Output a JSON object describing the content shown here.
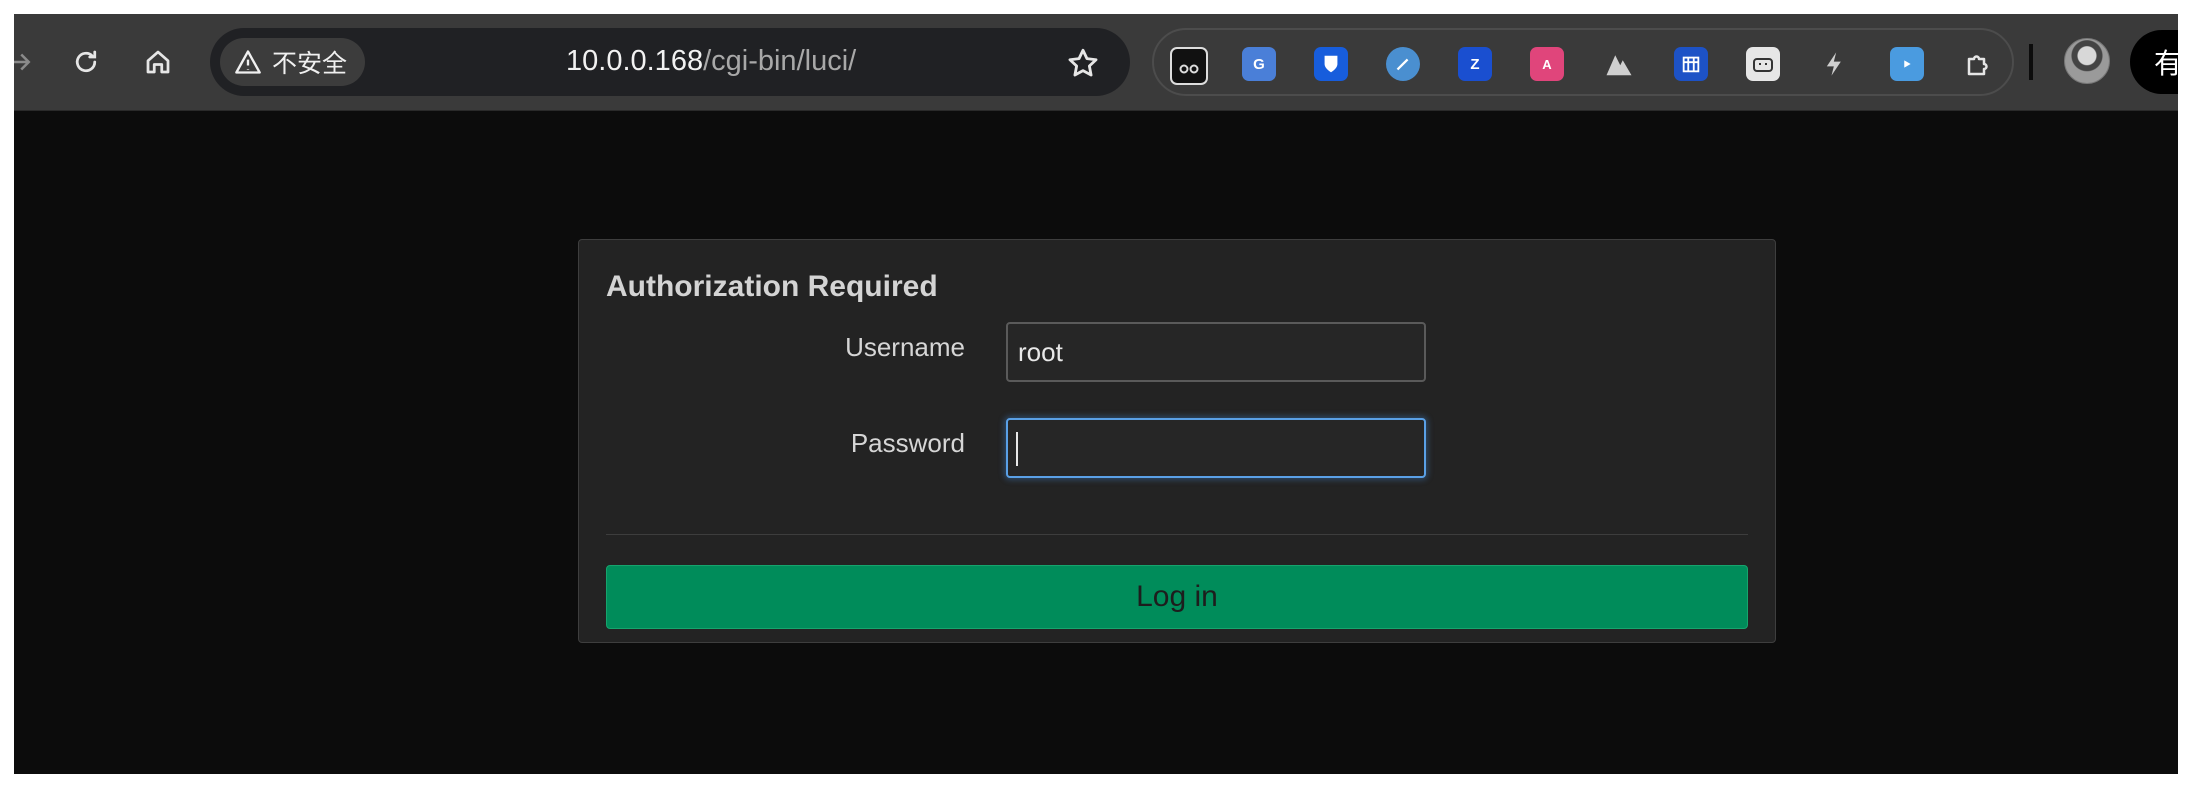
{
  "browser": {
    "security_label": "不安全",
    "url_host": "10.0.0.168",
    "url_path": "/cgi-bin/luci/",
    "profile_label": "有",
    "extensions": [
      {
        "icon": "glasses-extension-icon",
        "color": "#222222"
      },
      {
        "icon": "google-translate-icon",
        "color": "#4a7fd8"
      },
      {
        "icon": "bitwarden-icon",
        "color": "#175ddc"
      },
      {
        "icon": "pen-extension-icon",
        "color": "#4a8fd0"
      },
      {
        "icon": "zotero-connector-icon",
        "color": "#1a4fd0"
      },
      {
        "icon": "language-extension-icon",
        "color": "#e0457b"
      },
      {
        "icon": "mountain-extension-icon",
        "color": "#3a3a3a"
      },
      {
        "icon": "calendar-extension-icon",
        "color": "#1d52c6"
      },
      {
        "icon": "bilibili-cat-icon",
        "color": "#e6e6e6"
      },
      {
        "icon": "lightning-extension-icon",
        "color": "#3a3a3a"
      },
      {
        "icon": "tv-extension-icon",
        "color": "#4a9be0"
      },
      {
        "icon": "puzzle-extensions-icon",
        "color": "#3a3a3a"
      }
    ]
  },
  "login": {
    "title": "Authorization Required",
    "username_label": "Username",
    "username_value": "root",
    "password_label": "Password",
    "password_value": "",
    "submit_label": "Log in"
  },
  "colors": {
    "page_bg": "#0c0c0c",
    "card_bg": "#232323",
    "button_bg": "#008c5a",
    "focus_ring": "#5aa0e6"
  }
}
